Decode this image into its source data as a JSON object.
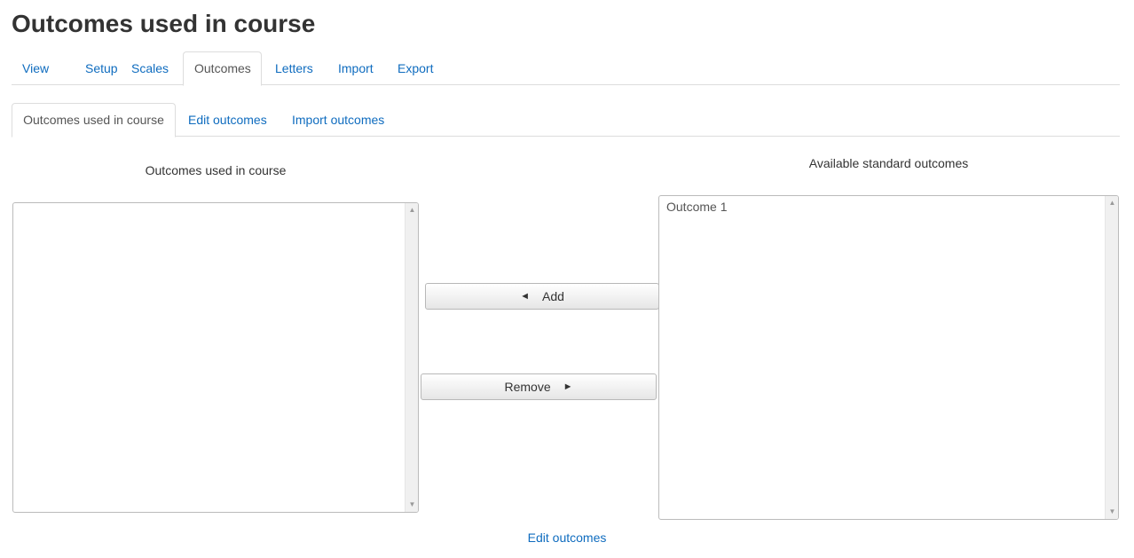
{
  "page": {
    "title": "Outcomes used in course"
  },
  "main_tabs": [
    {
      "label": "View"
    },
    {
      "label": "Setup"
    },
    {
      "label": "Scales"
    },
    {
      "label": "Outcomes",
      "active": true
    },
    {
      "label": "Letters"
    },
    {
      "label": "Import"
    },
    {
      "label": "Export"
    }
  ],
  "sub_tabs": [
    {
      "label": "Outcomes used in course",
      "active": true
    },
    {
      "label": "Edit outcomes"
    },
    {
      "label": "Import outcomes"
    }
  ],
  "left_panel": {
    "label": "Outcomes used in course",
    "options": []
  },
  "right_panel": {
    "label": "Available standard outcomes",
    "options": [
      "Outcome 1"
    ]
  },
  "buttons": {
    "add_label": "Add",
    "remove_label": "Remove",
    "add_icon": "left-triangle-icon",
    "remove_icon": "right-triangle-icon"
  },
  "footer": {
    "edit_link": "Edit outcomes"
  },
  "colors": {
    "link": "#0f6cbf",
    "text": "#333333",
    "border": "#dddddd"
  }
}
